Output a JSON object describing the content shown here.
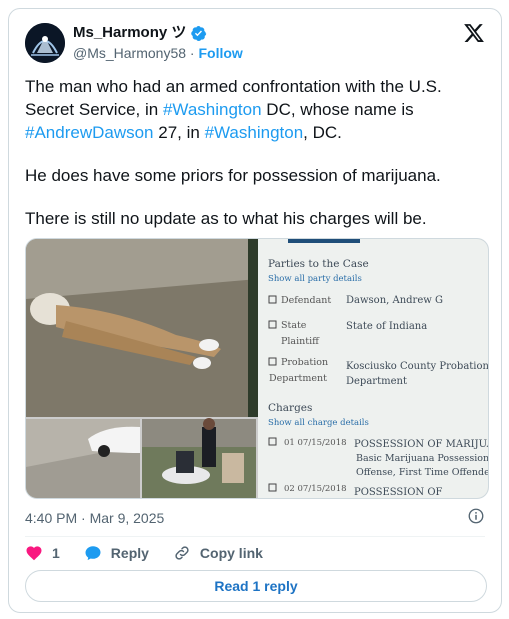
{
  "author": {
    "display_name": "Ms_Harmony ツ",
    "handle": "@Ms_Harmony58",
    "separator": " · ",
    "follow_label": "Follow"
  },
  "tweet": {
    "line1_prefix": "The man who had an armed confrontation with the  U.S. Secret Service, in ",
    "hashtag_washington": "#Washington",
    "line1_mid": " DC, whose name is ",
    "hashtag_andrew": "#AndrewDawson",
    "line1_mid2": " 27, in ",
    "line1_suffix": ", DC.",
    "para2": "He does have some priors for possession of marijuana.",
    "para3": "There is still no update as to what his charges will be."
  },
  "media": {
    "doc_header": "Parties to the Case",
    "doc_show_parties": "Show all party details",
    "parties": [
      {
        "role": "Defendant",
        "name": "Dawson, Andrew G"
      },
      {
        "role": "State Plaintiff",
        "name": "State of Indiana"
      },
      {
        "role": "Probation Department",
        "name": "Kosciusko County Probation Department"
      }
    ],
    "charges_header": "Charges",
    "charges_show": "Show all charge details",
    "charges": [
      {
        "num": "01",
        "date": "07/15/2018",
        "text": "POSSESSION OF MARIJUANA",
        "detail1": "Basic Marijuana Possession",
        "detail2": "Offense, First Time Offender."
      },
      {
        "num": "02",
        "date": "07/15/2018",
        "text": "POSSESSION OF"
      }
    ]
  },
  "meta": {
    "timestamp": "4:40 PM · Mar 9, 2025"
  },
  "actions": {
    "like_count": "1",
    "reply_label": "Reply",
    "copy_link_label": "Copy link",
    "read_replies_label": "Read 1 reply"
  },
  "colors": {
    "accent": "#1d9bf0",
    "like": "#f91880",
    "text": "#0f1419",
    "muted": "#536471"
  }
}
